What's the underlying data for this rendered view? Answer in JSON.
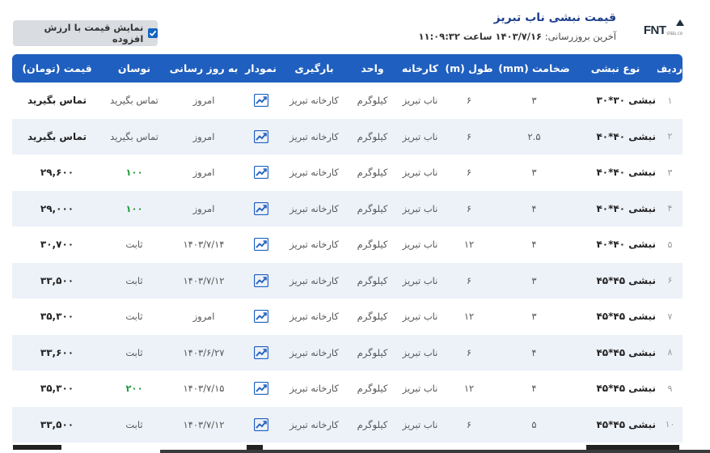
{
  "page": {
    "title": "قیمت نبشی ناب تبریز",
    "updated_label": "آخرین بروزرسانی:",
    "updated_value": "۱۴۰۳/۷/۱۶ ساعت ۱۱:۰۹:۳۲"
  },
  "logo": {
    "text": "FNT",
    "sub": "STEEL CO"
  },
  "vat_toggle": {
    "label": "نمایش قیمت با ارزش افزوده",
    "checked": true
  },
  "colors": {
    "header_bg": "#1f5fbf",
    "row_alt": "#edf2f9",
    "up": "#1e9b3a",
    "title": "#1e3f8c"
  },
  "table": {
    "headers": [
      "ردیف",
      "نوع نبشی",
      "ضخامت (mm)",
      "طول (m)",
      "کارخانه",
      "واحد",
      "بارگیری",
      "نمودار",
      "به روز رسانی",
      "نوسان",
      "قیمت (تومان)"
    ],
    "rows": [
      {
        "idx": "۱",
        "name": "نبشی ۳۰*۳۰",
        "thickness": "۳",
        "length": "۶",
        "factory": "ناب تبریز",
        "unit": "کیلوگرم",
        "loading": "کارخانه تبریز",
        "updated": "امروز",
        "change": "تماس بگیرید",
        "change_up": false,
        "price": "تماس بگیرید"
      },
      {
        "idx": "۲",
        "name": "نبشی ۴۰*۴۰",
        "thickness": "۲.۵",
        "length": "۶",
        "factory": "ناب تبریز",
        "unit": "کیلوگرم",
        "loading": "کارخانه تبریز",
        "updated": "امروز",
        "change": "تماس بگیرید",
        "change_up": false,
        "price": "تماس بگیرید"
      },
      {
        "idx": "۳",
        "name": "نبشی ۴۰*۴۰",
        "thickness": "۳",
        "length": "۶",
        "factory": "ناب تبریز",
        "unit": "کیلوگرم",
        "loading": "کارخانه تبریز",
        "updated": "امروز",
        "change": "۱۰۰",
        "change_up": true,
        "price": "۲۹,۶۰۰"
      },
      {
        "idx": "۴",
        "name": "نبشی ۴۰*۴۰",
        "thickness": "۴",
        "length": "۶",
        "factory": "ناب تبریز",
        "unit": "کیلوگرم",
        "loading": "کارخانه تبریز",
        "updated": "امروز",
        "change": "۱۰۰",
        "change_up": true,
        "price": "۲۹,۰۰۰"
      },
      {
        "idx": "۵",
        "name": "نبشی ۴۰*۴۰",
        "thickness": "۴",
        "length": "۱۲",
        "factory": "ناب تبریز",
        "unit": "کیلوگرم",
        "loading": "کارخانه تبریز",
        "updated": "۱۴۰۳/۷/۱۴",
        "change": "ثابت",
        "change_up": false,
        "price": "۳۰,۷۰۰"
      },
      {
        "idx": "۶",
        "name": "نبشی ۴۵*۴۵",
        "thickness": "۳",
        "length": "۶",
        "factory": "ناب تبریز",
        "unit": "کیلوگرم",
        "loading": "کارخانه تبریز",
        "updated": "۱۴۰۳/۷/۱۲",
        "change": "ثابت",
        "change_up": false,
        "price": "۳۳,۵۰۰"
      },
      {
        "idx": "۷",
        "name": "نبشی ۴۵*۴۵",
        "thickness": "۳",
        "length": "۱۲",
        "factory": "ناب تبریز",
        "unit": "کیلوگرم",
        "loading": "کارخانه تبریز",
        "updated": "امروز",
        "change": "ثابت",
        "change_up": false,
        "price": "۳۵,۳۰۰"
      },
      {
        "idx": "۸",
        "name": "نبشی ۴۵*۴۵",
        "thickness": "۴",
        "length": "۶",
        "factory": "ناب تبریز",
        "unit": "کیلوگرم",
        "loading": "کارخانه تبریز",
        "updated": "۱۴۰۳/۶/۲۷",
        "change": "ثابت",
        "change_up": false,
        "price": "۳۳,۶۰۰"
      },
      {
        "idx": "۹",
        "name": "نبشی ۴۵*۴۵",
        "thickness": "۴",
        "length": "۱۲",
        "factory": "ناب تبریز",
        "unit": "کیلوگرم",
        "loading": "کارخانه تبریز",
        "updated": "۱۴۰۳/۷/۱۵",
        "change": "۲۰۰",
        "change_up": true,
        "price": "۳۵,۳۰۰"
      },
      {
        "idx": "۱۰",
        "name": "نبشی ۴۵*۴۵",
        "thickness": "۵",
        "length": "۶",
        "factory": "ناب تبریز",
        "unit": "کیلوگرم",
        "loading": "کارخانه تبریز",
        "updated": "۱۴۰۳/۷/۱۲",
        "change": "ثابت",
        "change_up": false,
        "price": "۳۳,۵۰۰"
      }
    ]
  }
}
